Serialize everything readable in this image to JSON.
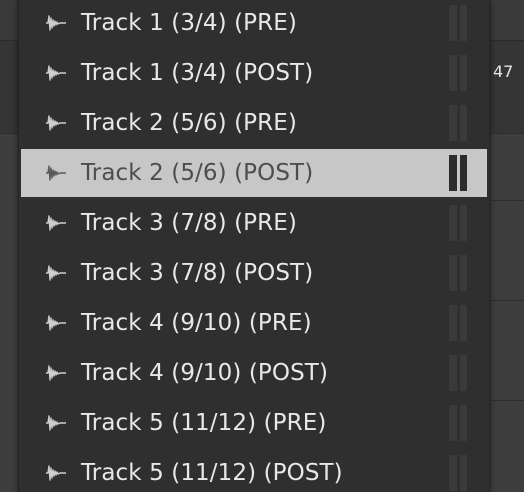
{
  "background": {
    "value_readout": "47"
  },
  "menu": {
    "items": [
      {
        "label": "Track 1 (3/4) (PRE)",
        "icon": "waveform-icon",
        "selected": false
      },
      {
        "label": "Track 1 (3/4) (POST)",
        "icon": "waveform-icon",
        "selected": false
      },
      {
        "label": "Track 2 (5/6) (PRE)",
        "icon": "waveform-icon",
        "selected": false
      },
      {
        "label": "Track 2 (5/6) (POST)",
        "icon": "waveform-icon",
        "selected": true
      },
      {
        "label": "Track 3 (7/8) (PRE)",
        "icon": "waveform-icon",
        "selected": false
      },
      {
        "label": "Track 3 (7/8) (POST)",
        "icon": "waveform-icon",
        "selected": false
      },
      {
        "label": "Track 4 (9/10) (PRE)",
        "icon": "waveform-icon",
        "selected": false
      },
      {
        "label": "Track 4 (9/10) (POST)",
        "icon": "waveform-icon",
        "selected": false
      },
      {
        "label": "Track 5 (11/12) (PRE)",
        "icon": "waveform-icon",
        "selected": false
      },
      {
        "label": "Track 5 (11/12) (POST)",
        "icon": "waveform-icon",
        "selected": false
      }
    ]
  },
  "colors": {
    "menu_bg": "#2f2f2f",
    "selected_bg": "#c7c7c7",
    "text": "#e8e8e8",
    "selected_text": "#4d4d4d"
  }
}
